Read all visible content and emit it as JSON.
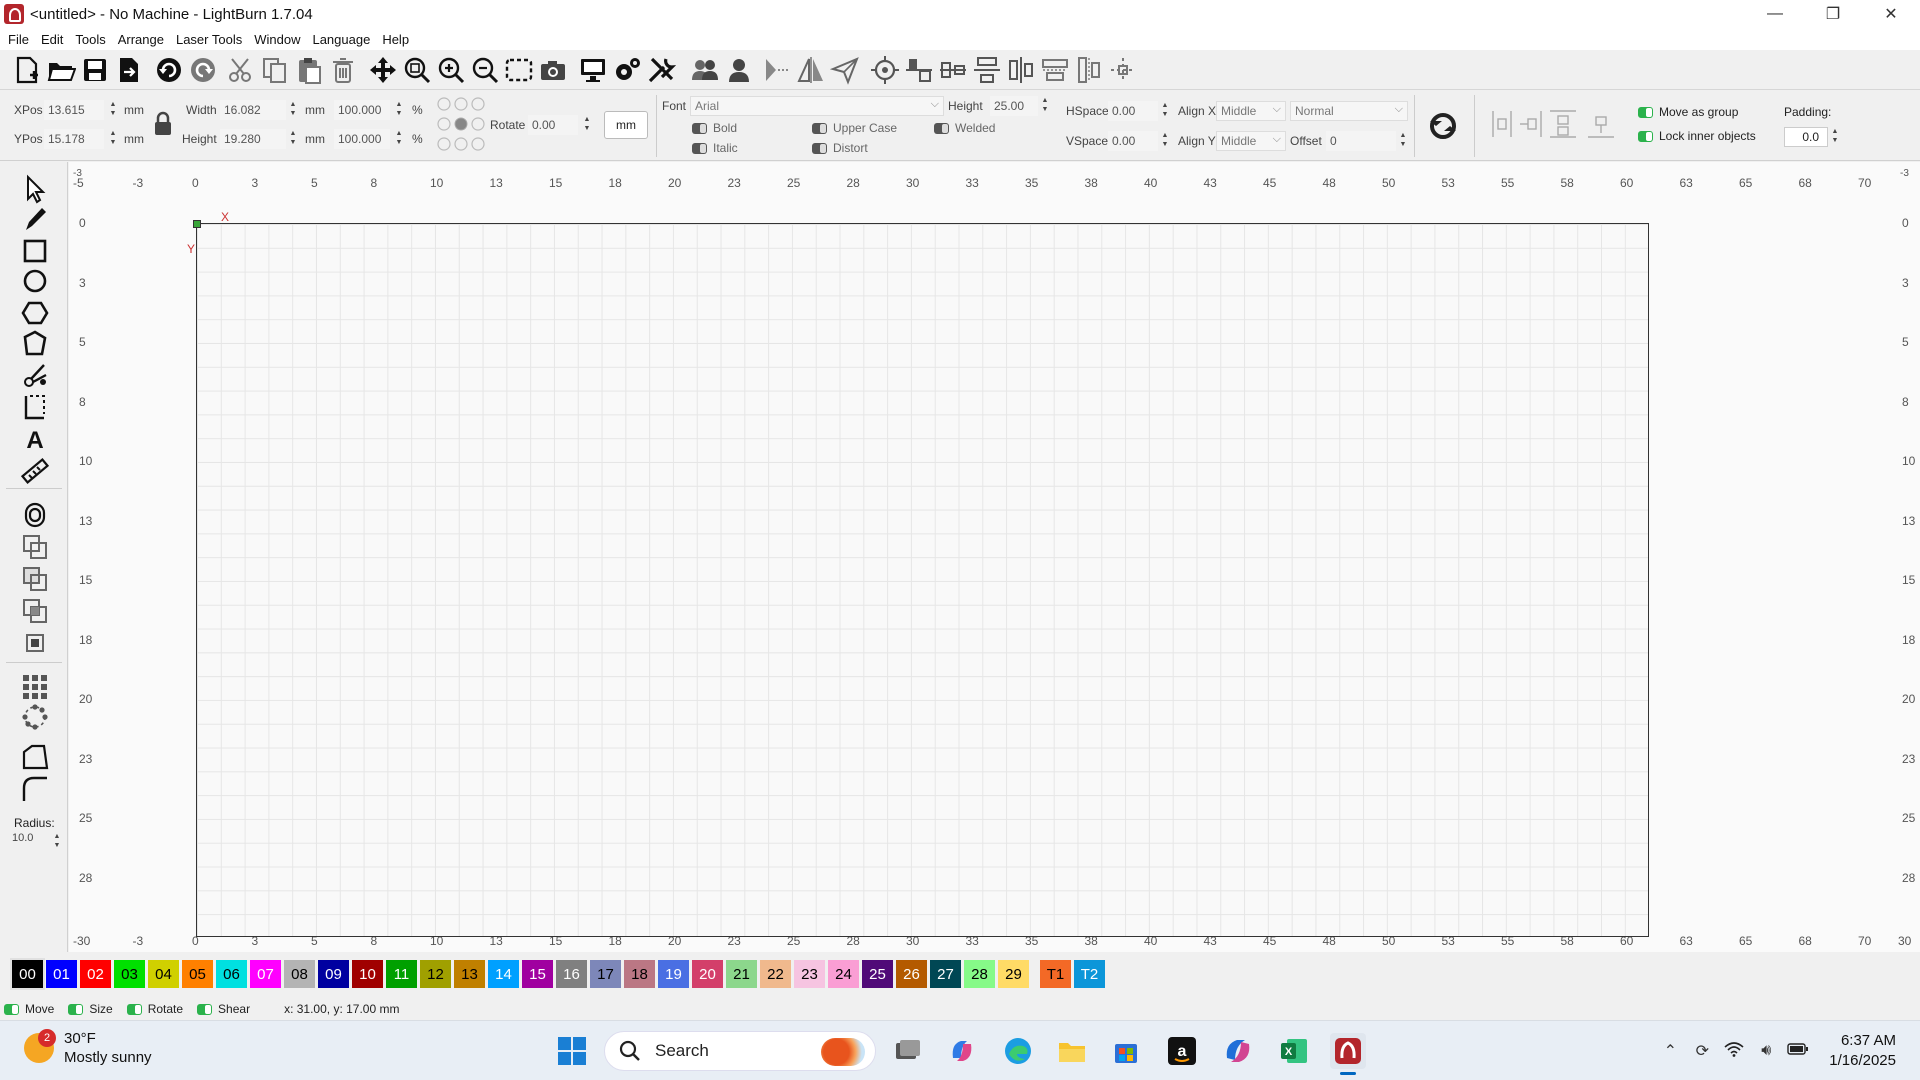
{
  "window": {
    "title": "<untitled> - No Machine - LightBurn 1.7.04",
    "minimize": "—",
    "restore": "❐",
    "close": "✕"
  },
  "menu": [
    "File",
    "Edit",
    "Tools",
    "Arrange",
    "Laser Tools",
    "Window",
    "Language",
    "Help"
  ],
  "toolbar_icons": [
    "new-file",
    "open-file",
    "save-file",
    "import",
    "undo",
    "redo",
    "cut",
    "copy",
    "paste",
    "delete",
    "move",
    "zoom-fit",
    "zoom-in",
    "zoom-out",
    "zoom-frame",
    "camera",
    "monitor",
    "settings",
    "machine-tools",
    "group",
    "ungroup",
    "mirror-h",
    "mirror-v",
    "send",
    "align-center",
    "align-top",
    "align-middle",
    "distribute",
    "dist-v",
    "align-x",
    "dist-h",
    "dist-space"
  ],
  "props": {
    "xpos_label": "XPos",
    "xpos": "13.615",
    "xpos_unit": "mm",
    "ypos_label": "YPos",
    "ypos": "15.178",
    "ypos_unit": "mm",
    "width_label": "Width",
    "width": "16.082",
    "width_unit": "mm",
    "width_pct": "100.000",
    "pct": "%",
    "height_label": "Height",
    "height": "19.280",
    "height_unit": "mm",
    "height_pct": "100.000",
    "rotate_label": "Rotate",
    "rotate": "0.00",
    "unit_button": "mm",
    "font_label": "Font",
    "font": "Arial",
    "text_height_label": "Height",
    "text_height": "25.00",
    "hspace_label": "HSpace",
    "hspace": "0.00",
    "vspace_label": "VSpace",
    "vspace": "0.00",
    "alignx_label": "Align X",
    "alignx": "Middle",
    "aligny_label": "Align Y",
    "aligny": "Middle",
    "style": "Normal",
    "offset_label": "Offset",
    "offset": "0",
    "bold": "Bold",
    "italic": "Italic",
    "upper_case": "Upper Case",
    "distort": "Distort",
    "welded": "Welded",
    "move_as_group": "Move as group",
    "lock_inner": "Lock inner objects",
    "padding_label": "Padding:",
    "padding": "0.0"
  },
  "tools": [
    "select-tool",
    "pen-tool",
    "rectangle-tool",
    "ellipse-tool",
    "polygon-tool",
    "polyline-tool",
    "node-edit-tool",
    "trim-tool",
    "text-tool",
    "measure-tool",
    "offset-tool",
    "boolean-union",
    "boolean-subtract",
    "boolean-intersect",
    "weld-tool",
    "grid-array",
    "circular-array",
    "corner-tool",
    "fillet-tool"
  ],
  "radius": {
    "label": "Radius:",
    "value": "10.0"
  },
  "rulers": {
    "top": [
      "-5",
      "-3",
      "0",
      "3",
      "5",
      "8",
      "10",
      "13",
      "15",
      "18",
      "20",
      "23",
      "25",
      "28",
      "30",
      "33",
      "35",
      "38",
      "40",
      "43",
      "45",
      "48",
      "50",
      "53",
      "55",
      "58",
      "60",
      "63",
      "65",
      "68",
      "70"
    ],
    "left": [
      "0",
      "3",
      "5",
      "8",
      "10",
      "13",
      "15",
      "18",
      "20",
      "23",
      "25",
      "28",
      "30"
    ],
    "top_edge": "-3",
    "bottom_edge_left": "-30",
    "bottom_edge_right": "30",
    "right_top_edge": "-3"
  },
  "axis": {
    "x": "X",
    "y": "Y"
  },
  "palette": [
    {
      "label": "00",
      "bg": "#000000",
      "fg": "#ffffff"
    },
    {
      "label": "01",
      "bg": "#0000ff",
      "fg": "#ffffff"
    },
    {
      "label": "02",
      "bg": "#ff0000",
      "fg": "#ffffff"
    },
    {
      "label": "03",
      "bg": "#00e000",
      "fg": "#000000"
    },
    {
      "label": "04",
      "bg": "#d0d000",
      "fg": "#000000"
    },
    {
      "label": "05",
      "bg": "#ff8000",
      "fg": "#000000"
    },
    {
      "label": "06",
      "bg": "#00e0e0",
      "fg": "#000000"
    },
    {
      "label": "07",
      "bg": "#ff00ff",
      "fg": "#ffffff"
    },
    {
      "label": "08",
      "bg": "#b4b4b4",
      "fg": "#000000"
    },
    {
      "label": "09",
      "bg": "#0000a0",
      "fg": "#ffffff"
    },
    {
      "label": "10",
      "bg": "#a00000",
      "fg": "#ffffff"
    },
    {
      "label": "11",
      "bg": "#00a000",
      "fg": "#ffffff"
    },
    {
      "label": "12",
      "bg": "#a0a000",
      "fg": "#000000"
    },
    {
      "label": "13",
      "bg": "#c08000",
      "fg": "#000000"
    },
    {
      "label": "14",
      "bg": "#00a0ff",
      "fg": "#ffffff"
    },
    {
      "label": "15",
      "bg": "#a000a0",
      "fg": "#ffffff"
    },
    {
      "label": "16",
      "bg": "#808080",
      "fg": "#ffffff"
    },
    {
      "label": "17",
      "bg": "#7d87b9",
      "fg": "#000000"
    },
    {
      "label": "18",
      "bg": "#bb7784",
      "fg": "#000000"
    },
    {
      "label": "19",
      "bg": "#4a6fe3",
      "fg": "#ffffff"
    },
    {
      "label": "20",
      "bg": "#d33f6a",
      "fg": "#ffffff"
    },
    {
      "label": "21",
      "bg": "#8cd78c",
      "fg": "#000000"
    },
    {
      "label": "22",
      "bg": "#f0b98d",
      "fg": "#000000"
    },
    {
      "label": "23",
      "bg": "#f6c4e1",
      "fg": "#000000"
    },
    {
      "label": "24",
      "bg": "#fa9ed4",
      "fg": "#000000"
    },
    {
      "label": "25",
      "bg": "#500a78",
      "fg": "#ffffff"
    },
    {
      "label": "26",
      "bg": "#b45a00",
      "fg": "#ffffff"
    },
    {
      "label": "27",
      "bg": "#004754",
      "fg": "#ffffff"
    },
    {
      "label": "28",
      "bg": "#86fa88",
      "fg": "#000000"
    },
    {
      "label": "29",
      "bg": "#ffdb66",
      "fg": "#000000"
    },
    {
      "label": "T1",
      "bg": "#f36926",
      "fg": "#000000"
    },
    {
      "label": "T2",
      "bg": "#0c96d9",
      "fg": "#ffffff"
    }
  ],
  "status": {
    "move": "Move",
    "size": "Size",
    "rotate": "Rotate",
    "shear": "Shear",
    "coords": "x: 31.00, y: 17.00 mm"
  },
  "taskbar": {
    "weather_badge": "2",
    "temp": "30°F",
    "condition": "Mostly sunny",
    "search": "Search",
    "time": "6:37 AM",
    "date": "1/16/2025",
    "accent": "#0067c0"
  }
}
